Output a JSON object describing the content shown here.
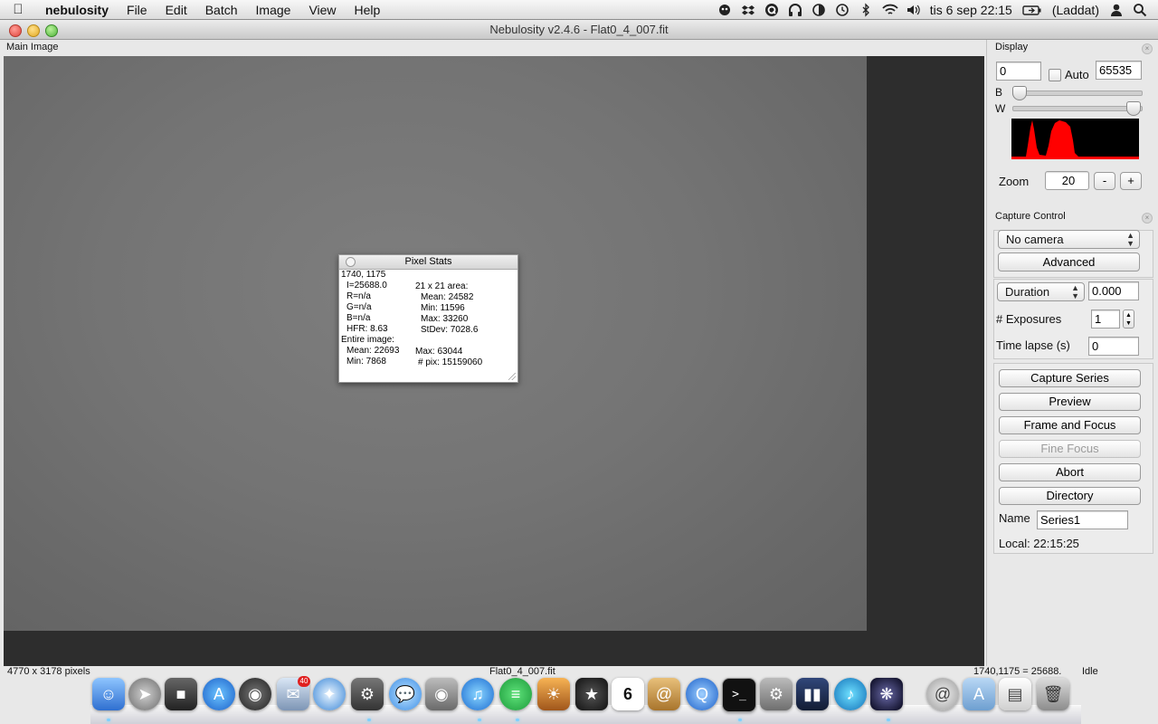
{
  "menubar": {
    "app": "nebulosity",
    "items": [
      "File",
      "Edit",
      "Batch",
      "Image",
      "View",
      "Help"
    ],
    "clock": "tis 6 sep  22:15",
    "battery_text": "(Laddat)"
  },
  "window": {
    "title": "Nebulosity v2.4.6 - Flat0_4_007.fit"
  },
  "main": {
    "caption": "Main Image"
  },
  "pixel_stats": {
    "title": "Pixel Stats",
    "coords": "1740, 1175",
    "intensity": "I=25688.0",
    "r": "R=n/a",
    "g": "G=n/a",
    "b": "B=n/a",
    "hfr": "HFR: 8.63",
    "area_label": "21 x 21 area:",
    "area_mean": "Mean: 24582",
    "area_min": "Min: 11596",
    "area_max": "Max: 33260",
    "area_stdev": "StDev: 7028.6",
    "entire_label": "Entire image:",
    "entire_mean": "Mean: 22693",
    "entire_max": "Max: 63044",
    "entire_min": "Min: 7868",
    "entire_pix": "# pix: 15159060"
  },
  "display": {
    "caption": "Display",
    "black_value": "0",
    "auto_label": "Auto",
    "auto_checked": false,
    "white_value": "65535",
    "b_label": "B",
    "w_label": "W",
    "b_slider_fraction": 0.0,
    "w_slider_fraction": 1.0,
    "zoom_label": "Zoom",
    "zoom_value": "20",
    "zoom_minus": "-",
    "zoom_plus": "+",
    "histogram_color": "#ff0000"
  },
  "capture": {
    "caption": "Capture Control",
    "camera": "No camera",
    "advanced": "Advanced",
    "duration_select": "Duration",
    "duration_value": "0.000",
    "exposures_label": "# Exposures",
    "exposures_value": "1",
    "timelapse_label": "Time lapse (s)",
    "timelapse_value": "0",
    "capture_series": "Capture Series",
    "preview": "Preview",
    "frame_focus": "Frame and Focus",
    "fine_focus": "Fine Focus",
    "abort": "Abort",
    "directory": "Directory",
    "name_label": "Name",
    "name_value": "Series1",
    "local_time": "Local: 22:15:25"
  },
  "status": {
    "dimensions": "4770 x 3178 pixels",
    "filename": "Flat0_4_007.fit",
    "pixel_readout": "1740,1175 = 25688.",
    "state": "Idle"
  },
  "dock": {
    "badge": "40",
    "calendar_day": "6",
    "icons": [
      "finder-icon",
      "launchpad-icon",
      "photo-booth-icon",
      "app-store-icon",
      "dashboard-icon",
      "mail-icon",
      "safari-icon",
      "automator-icon",
      "messages-icon",
      "facetime-icon",
      "itunes-icon",
      "spotify-icon",
      "iphoto-icon",
      "imovie-icon",
      "calendar-icon",
      "address-book-icon",
      "quicktime-icon",
      "terminal-icon",
      "system-preferences-icon",
      "photoshop-icon",
      "itunes-alt-icon",
      "nebulosity-icon",
      "airmail-icon",
      "applications-folder-icon",
      "documents-stack-icon",
      "trash-icon"
    ]
  }
}
